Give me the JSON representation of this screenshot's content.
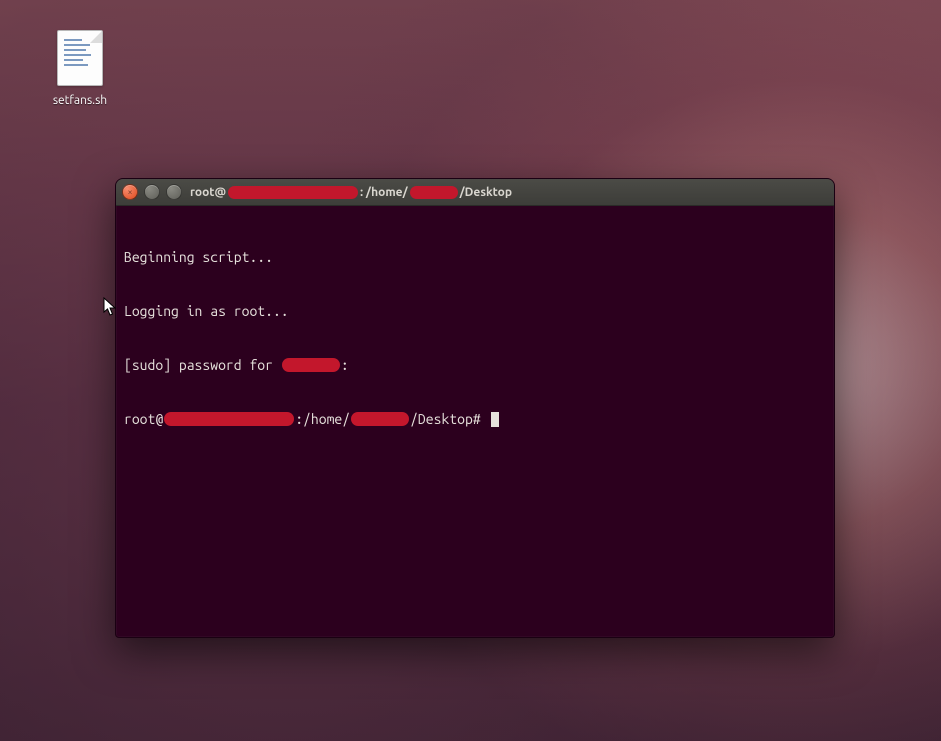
{
  "desktop_icon": {
    "filename": "setfans.sh"
  },
  "terminal": {
    "title": {
      "prefix": "root@",
      "sep1": ": /home/",
      "suffix": "/Desktop"
    },
    "lines": {
      "l1": "Beginning script...",
      "l2": "Logging in as root...",
      "l3a": "[sudo] password for ",
      "l3b": ":",
      "l4a": "root@",
      "l4b": ":/home/",
      "l4c": "/Desktop# "
    }
  }
}
